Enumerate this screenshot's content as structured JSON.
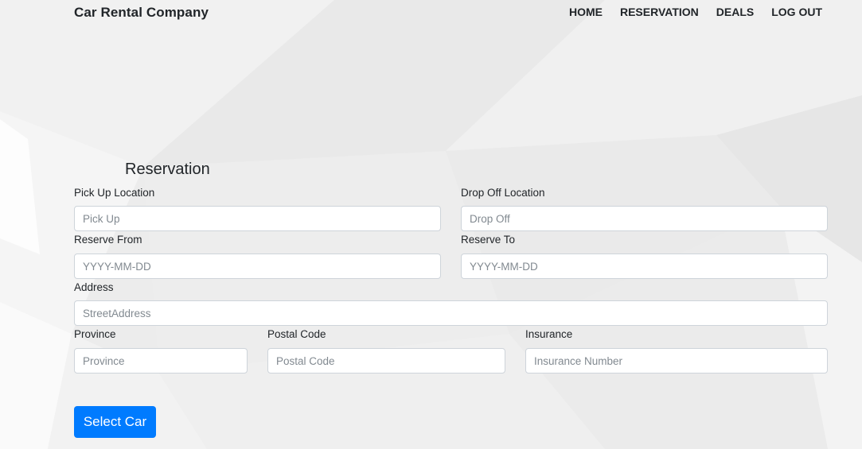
{
  "header": {
    "brand": "Car Rental Company",
    "nav": [
      "HOME",
      "RESERVATION",
      "DEALS",
      "LOG OUT"
    ]
  },
  "form": {
    "title": "Reservation",
    "pickup": {
      "label": "Pick Up Location",
      "placeholder": "Pick Up",
      "value": ""
    },
    "dropoff": {
      "label": "Drop Off Location",
      "placeholder": "Drop Off",
      "value": ""
    },
    "reserve_from": {
      "label": "Reserve From",
      "placeholder": "YYYY-MM-DD",
      "value": ""
    },
    "reserve_to": {
      "label": "Reserve To",
      "placeholder": "YYYY-MM-DD",
      "value": ""
    },
    "address": {
      "label": "Address",
      "placeholder": "StreetAddress",
      "value": ""
    },
    "province": {
      "label": "Province",
      "placeholder": "Province",
      "value": ""
    },
    "postal_code": {
      "label": "Postal Code",
      "placeholder": "Postal Code",
      "value": ""
    },
    "insurance": {
      "label": "Insurance",
      "placeholder": "Insurance Number",
      "value": ""
    },
    "submit_label": "Select Car"
  },
  "theme": {
    "primary": "#007bff",
    "text": "#212529",
    "background": "#ededed"
  }
}
